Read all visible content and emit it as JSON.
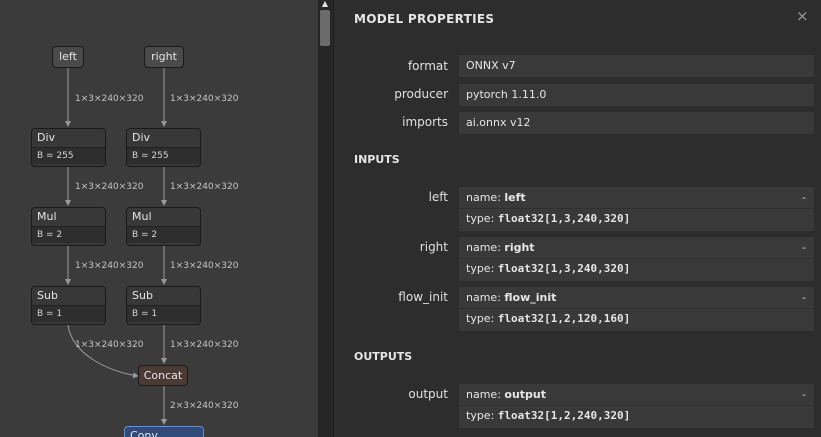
{
  "graph": {
    "inputs": [
      {
        "label": "left"
      },
      {
        "label": "right"
      }
    ],
    "nodes": [
      {
        "type": "Div",
        "attr": "B = 255"
      },
      {
        "type": "Div",
        "attr": "B = 255"
      },
      {
        "type": "Mul",
        "attr": "B = 2"
      },
      {
        "type": "Mul",
        "attr": "B = 2"
      },
      {
        "type": "Sub",
        "attr": "B = 1"
      },
      {
        "type": "Sub",
        "attr": "B = 1"
      }
    ],
    "concat": "Concat",
    "conv": "Conv",
    "edges": {
      "shape_input": "1×3×240×320",
      "shape_concat_out": "2×3×240×320"
    }
  },
  "panel": {
    "title": "MODEL PROPERTIES",
    "close_icon": "×",
    "properties": [
      {
        "label": "format",
        "value": "ONNX v7"
      },
      {
        "label": "producer",
        "value": "pytorch 1.11.0"
      },
      {
        "label": "imports",
        "value": "ai.onnx v12"
      }
    ],
    "inputs_title": "INPUTS",
    "inputs": [
      {
        "label": "left",
        "name_prefix": "name: ",
        "name": "left",
        "type_prefix": "type: ",
        "type": "float32[1,3,240,320]",
        "dash": "-"
      },
      {
        "label": "right",
        "name_prefix": "name: ",
        "name": "right",
        "type_prefix": "type: ",
        "type": "float32[1,3,240,320]",
        "dash": "-"
      },
      {
        "label": "flow_init",
        "name_prefix": "name: ",
        "name": "flow_init",
        "type_prefix": "type: ",
        "type": "float32[1,2,120,160]",
        "dash": "-"
      }
    ],
    "outputs_title": "OUTPUTS",
    "outputs": [
      {
        "label": "output",
        "name_prefix": "name: ",
        "name": "output",
        "type_prefix": "type: ",
        "type": "float32[1,2,240,320]",
        "dash": "-"
      }
    ]
  },
  "colors": {
    "graph_bg": "#3b3b3b",
    "panel_bg": "#2d2d2d",
    "value_bg": "#393939",
    "concat_bg": "#4b3a35",
    "conv_bg": "#2f4c79",
    "conv_border": "#6691d1"
  },
  "icons": {
    "scroll_up": "▲"
  }
}
